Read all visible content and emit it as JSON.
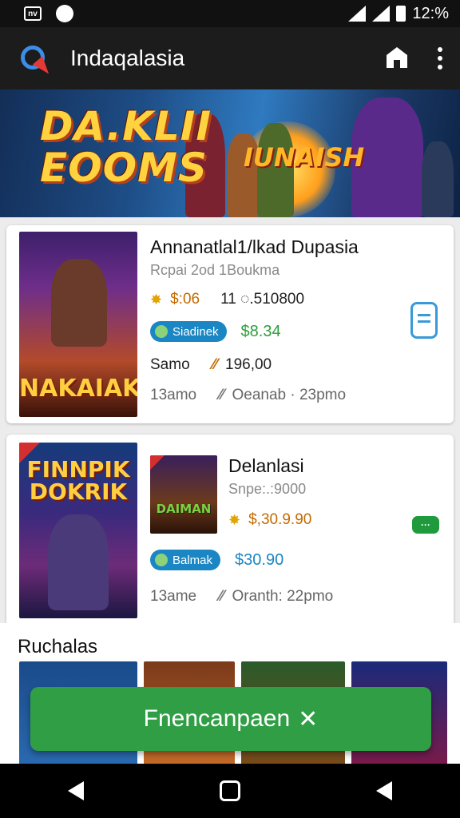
{
  "status_bar": {
    "time": "12:%",
    "left_icons": [
      "nv-icon",
      "app-circle-icon"
    ],
    "right_icons": [
      "wifi-icon",
      "signal-icon",
      "battery-icon"
    ]
  },
  "app_bar": {
    "title": "Indaqalasia",
    "icons": [
      "app-logo-icon",
      "shield-icon",
      "more-vert-icon"
    ]
  },
  "banner": {
    "title_line1": "DA.KLII",
    "title_line2": "EOOMS",
    "subtitle": "IUNAISH"
  },
  "cards": [
    {
      "poster_text": "NAKAIAK",
      "title": "Annanatlal1/lkad Dupasia",
      "subtitle": "Rcpai 2od 1Boukma",
      "price": "$:06",
      "count": "11 ◌.510800",
      "pill_label": "Siadinek",
      "pill_value": "$8.34",
      "row3_label": "Samo",
      "row3_value": "196,00",
      "row4_label": "13amo",
      "row4_value": "Oeanab · 23pmo"
    },
    {
      "poster_text": "FINNPIK DOKRIK",
      "title": "Delanlasi",
      "subtitle": "Snpe:.:9000",
      "thumb_text": "DAIMAN",
      "price": "$,30.9.90",
      "pill_label": "Balmak",
      "pill_value": "$30.90",
      "row4_label": "13ame",
      "row4_value": "Oranth: 22pmo",
      "chat_badge": "···"
    }
  ],
  "section": {
    "title": "Ruchalas"
  },
  "fab": {
    "label": "Fnencanpaen",
    "icon": "✕"
  },
  "nav": {
    "buttons": [
      "back-icon",
      "home-icon",
      "recent-icon"
    ]
  },
  "colors": {
    "appbar": "#1c1c1c",
    "accent_green": "#2f9e44",
    "pill_blue": "#1a86c4"
  }
}
